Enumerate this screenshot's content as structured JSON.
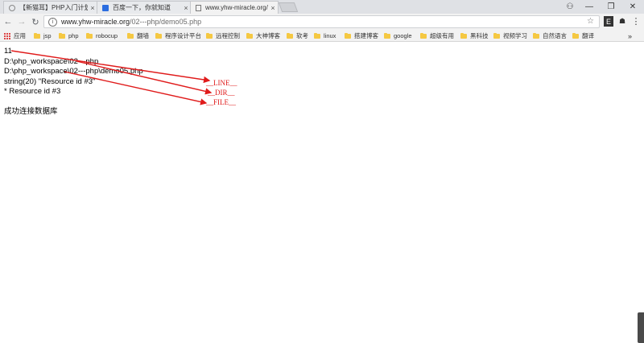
{
  "tabs": [
    {
      "title": "【新猫耳】PHP入门计划",
      "close": "×"
    },
    {
      "title": "百度一下，你就知道",
      "close": "×"
    },
    {
      "title": "www.yhw-miracle.org/",
      "close": "×"
    }
  ],
  "window_controls": {
    "profile": "⚇",
    "minimize": "—",
    "restore": "❐",
    "close": "✕"
  },
  "toolbar": {
    "back": "←",
    "forward": "→",
    "reload": "↻",
    "info": "i",
    "star": "☆",
    "ext1": "E",
    "ext2": "☗",
    "menu": "⋮"
  },
  "address": {
    "host": "www.yhw-miracle.org",
    "path": "/02---php/demo05.php"
  },
  "bookmarks": {
    "apps_label": "应用",
    "items": [
      "jsp",
      "php",
      "robocup",
      "翻墙",
      "程序设计平台",
      "远程控制",
      "大神博客",
      "软考",
      "linux",
      "搭建博客",
      "google",
      "超级有用",
      "黑科技",
      "视频学习",
      "自然语言",
      "翻译"
    ],
    "overflow": "»"
  },
  "content": {
    "lines": [
      "11",
      "D:\\php_workspace\\02---php",
      "D:\\php_workspace\\02---php\\demo05.php",
      "string(20) \"Resource id #3\"",
      "* Resource id #3"
    ],
    "result": "成功连接数据库"
  },
  "annotations": {
    "line": "__LINE__",
    "dir": "__DIR__",
    "file": "__FILE__"
  },
  "colors": {
    "annotation": "#e01b1b"
  }
}
